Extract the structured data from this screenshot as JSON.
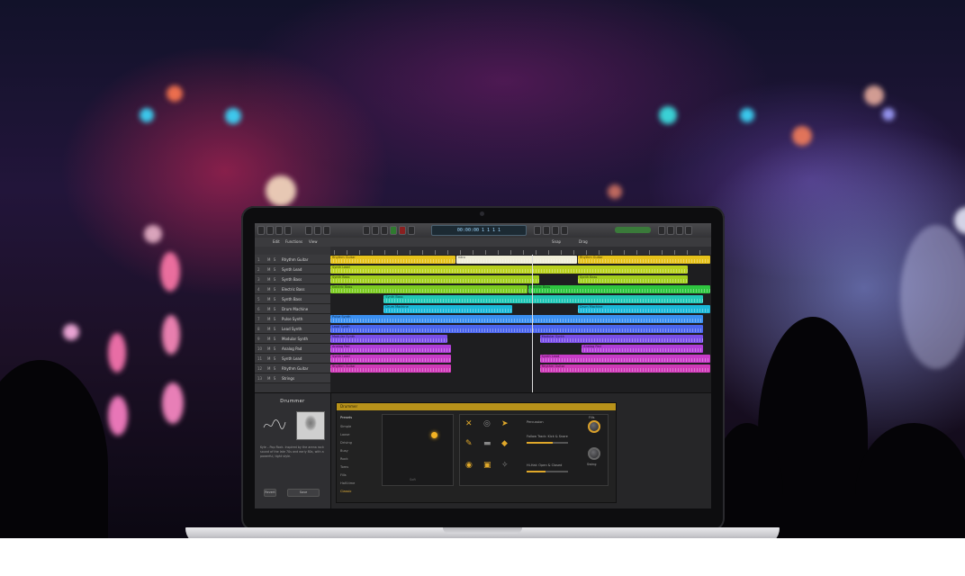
{
  "app": {
    "name": "Logic Pro X",
    "lcd_display": "00:00:00  1 1 1 1"
  },
  "toolbar": {
    "left_menu_items": [
      "Edit",
      "Functions",
      "View"
    ],
    "snap_label": "Snap",
    "drag_label": "Drag"
  },
  "tracks": [
    {
      "number": "1",
      "name": "Rhythm Guitar"
    },
    {
      "number": "2",
      "name": "Synth Lead"
    },
    {
      "number": "3",
      "name": "Synth Bass"
    },
    {
      "number": "4",
      "name": "Electric Bass"
    },
    {
      "number": "5",
      "name": "Synth Bass"
    },
    {
      "number": "6",
      "name": "Drum Machine"
    },
    {
      "number": "7",
      "name": "Pulse Synth"
    },
    {
      "number": "8",
      "name": "Lead Synth"
    },
    {
      "number": "9",
      "name": "Modular Synth"
    },
    {
      "number": "10",
      "name": "Analog Pad"
    },
    {
      "number": "11",
      "name": "Synth Lead"
    },
    {
      "number": "12",
      "name": "Rhythm Guitar"
    },
    {
      "number": "13",
      "name": "Strings"
    }
  ],
  "regions": [
    {
      "row": 0,
      "start": 0.0,
      "end": 0.33,
      "color": "#e6c21b",
      "label": "Rhythm Guitar"
    },
    {
      "row": 0,
      "start": 0.33,
      "end": 0.65,
      "color": "#f0eed8",
      "label": "Intro"
    },
    {
      "row": 0,
      "start": 0.65,
      "end": 1.0,
      "color": "#e6c21b",
      "label": "Rhythm Guitar"
    },
    {
      "row": 1,
      "start": 0.0,
      "end": 0.94,
      "color": "#b9d21e",
      "label": "Synth Lead"
    },
    {
      "row": 2,
      "start": 0.0,
      "end": 0.55,
      "color": "#a2cf1e",
      "label": "Synth Bass"
    },
    {
      "row": 2,
      "start": 0.65,
      "end": 0.94,
      "color": "#a2cf1e",
      "label": "Synth Bass"
    },
    {
      "row": 3,
      "start": 0.0,
      "end": 0.52,
      "color": "#7ccc22",
      "label": "Electric Bass"
    },
    {
      "row": 3,
      "start": 0.52,
      "end": 1.0,
      "color": "#2fc640",
      "label": "Electric Bass"
    },
    {
      "row": 4,
      "start": 0.14,
      "end": 0.98,
      "color": "#21c7b6",
      "label": "Synth Bass"
    },
    {
      "row": 5,
      "start": 0.14,
      "end": 0.48,
      "color": "#1bb8d8",
      "label": "Drum Machine"
    },
    {
      "row": 5,
      "start": 0.65,
      "end": 1.0,
      "color": "#1bb8d8",
      "label": "Drum Machine"
    },
    {
      "row": 6,
      "start": 0.0,
      "end": 0.98,
      "color": "#3a8ff0",
      "label": "Pulse Synth"
    },
    {
      "row": 7,
      "start": 0.0,
      "end": 0.98,
      "color": "#4b66ee",
      "label": "Lead Synth"
    },
    {
      "row": 8,
      "start": 0.0,
      "end": 0.31,
      "color": "#7a4fe8",
      "label": "Modular Synth"
    },
    {
      "row": 8,
      "start": 0.55,
      "end": 0.98,
      "color": "#7a4fe8",
      "label": "Modular Synth"
    },
    {
      "row": 9,
      "start": 0.0,
      "end": 0.32,
      "color": "#b03ed8",
      "label": "Analog Pad"
    },
    {
      "row": 9,
      "start": 0.66,
      "end": 0.98,
      "color": "#b03ed8",
      "label": "Analog Pad"
    },
    {
      "row": 10,
      "start": 0.0,
      "end": 0.32,
      "color": "#c83cc8",
      "label": "Synth Lead"
    },
    {
      "row": 10,
      "start": 0.55,
      "end": 1.0,
      "color": "#c83cc8",
      "label": "Synth Lead"
    },
    {
      "row": 11,
      "start": 0.0,
      "end": 0.32,
      "color": "#cf3ab8",
      "label": "Rhythm Guitar"
    },
    {
      "row": 11,
      "start": 0.55,
      "end": 1.0,
      "color": "#cf3ab8",
      "label": "Rhythm Guitar"
    }
  ],
  "library": {
    "title": "Drummer",
    "description": "Kyle – Pop Rock. Inspired by the arena rock sound of the late 70s and early 80s, with a powerful, tight style."
  },
  "library_buttons": [
    "Revert",
    "Save"
  ],
  "smart_controls": {
    "header": "Drummer",
    "presets_title": "Presets",
    "presets": [
      "Simple",
      "Loose",
      "Driving",
      "Busy",
      "Rock",
      "Toms",
      "Fills",
      "Half-time",
      "Classic"
    ],
    "active_preset_index": 8,
    "xy_label": "Soft",
    "fill_label": "Follow Track: Kick & Snare",
    "swing_label": "Percussion",
    "hihat_label": "Hi-Hat: Open & Closed",
    "fills_knob_label": "Fills",
    "swing_knob_label": "Swing",
    "fill_level": 0.62,
    "hihat_level": 0.45
  },
  "colors": {
    "accent": "#e0a82a",
    "cpu_meter": "#3a7a3a"
  }
}
